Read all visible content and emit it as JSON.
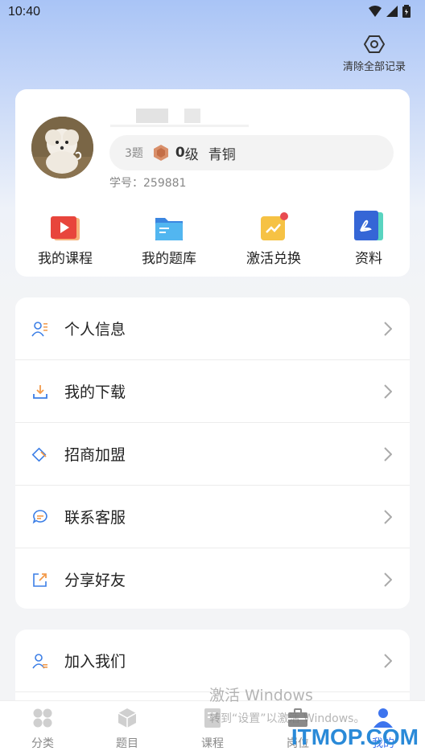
{
  "status_bar": {
    "time": "10:40"
  },
  "header": {
    "clear_label": "清除全部记录",
    "clear_icon": "gear-icon"
  },
  "profile": {
    "question_count": "3题",
    "level_number": "0",
    "level_suffix": "级",
    "rank": "青铜",
    "student_id": "学号：259881",
    "medal_icon": "medal-icon"
  },
  "shortcuts": [
    {
      "label": "我的课程",
      "icon": "video-course-icon"
    },
    {
      "label": "我的题库",
      "icon": "folder-icon"
    },
    {
      "label": "激活兑换",
      "icon": "activation-icon"
    },
    {
      "label": "资料",
      "icon": "pdf-document-icon"
    }
  ],
  "menu": [
    {
      "label": "个人信息",
      "icon": "user-info-icon"
    },
    {
      "label": "我的下载",
      "icon": "download-icon"
    },
    {
      "label": "招商加盟",
      "icon": "handshake-icon"
    },
    {
      "label": "联系客服",
      "icon": "chat-bubble-icon"
    },
    {
      "label": "分享好友",
      "icon": "share-icon"
    }
  ],
  "menu2": [
    {
      "label": "加入我们",
      "icon": "join-us-icon"
    }
  ],
  "bottom_nav": [
    {
      "label": "分类",
      "icon": "category-icon"
    },
    {
      "label": "题目",
      "icon": "cube-icon"
    },
    {
      "label": "课程",
      "icon": "book-icon"
    },
    {
      "label": "岗位",
      "icon": "briefcase-icon"
    },
    {
      "label": "我的",
      "icon": "person-icon",
      "active": true
    }
  ],
  "watermark": {
    "line1": "激活 Windows",
    "line2": "转到“设置”以激活 Windows。"
  },
  "brand": "ITMOP.COM",
  "colors": {
    "accent": "#3d74ee",
    "brand": "#2a8ad8",
    "shortcut_red": "#e8453c",
    "shortcut_blue": "#3b86e0",
    "shortcut_yellow": "#f6c244"
  }
}
